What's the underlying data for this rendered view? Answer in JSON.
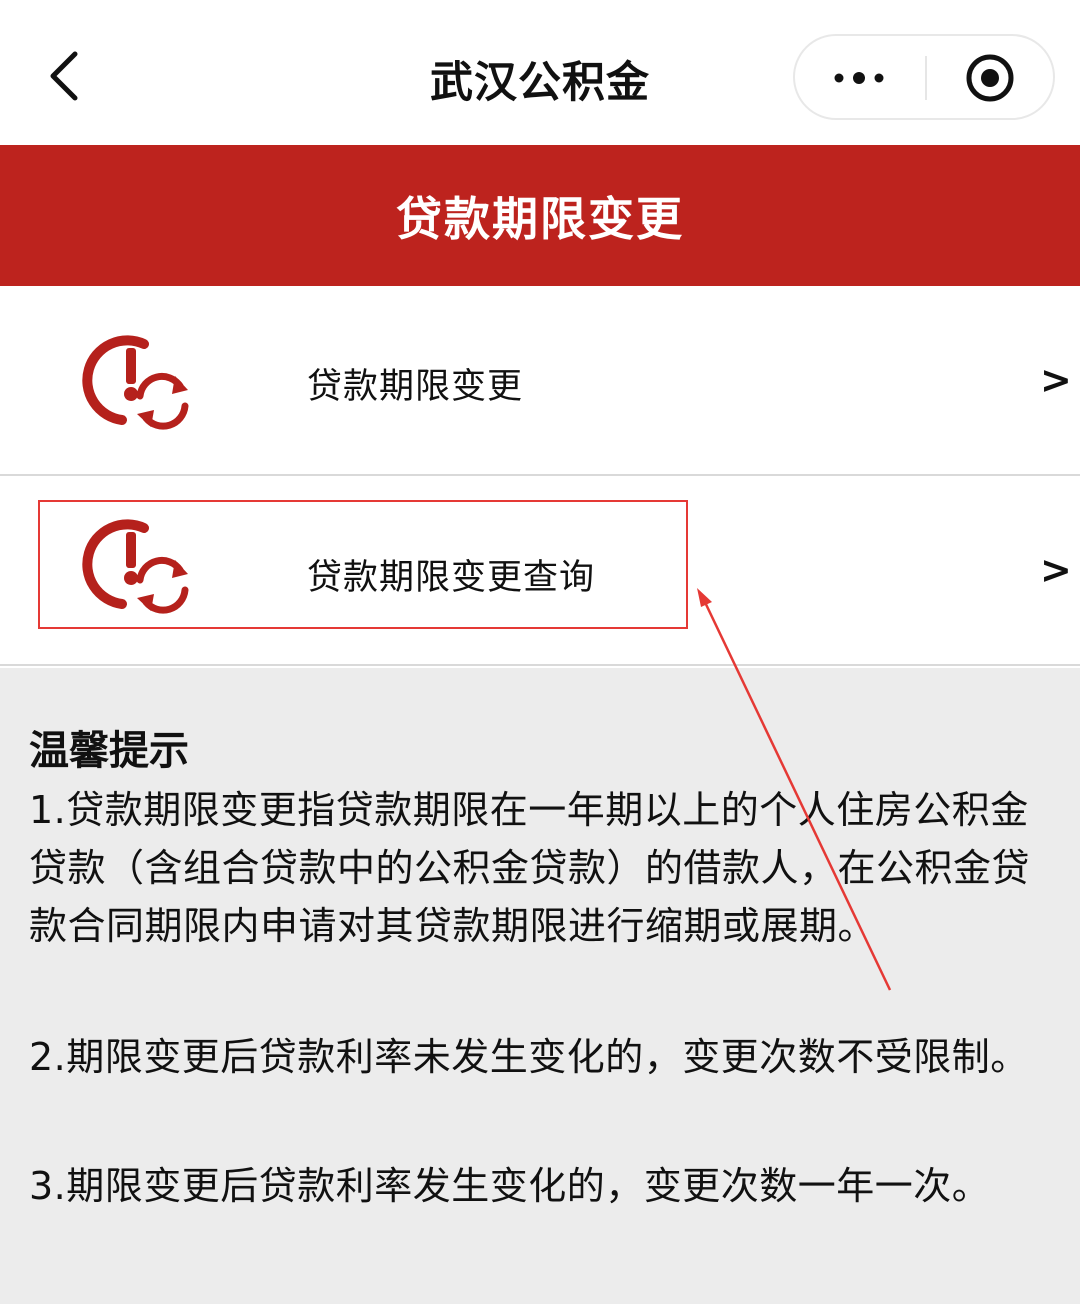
{
  "navbar": {
    "title": "武汉公积金",
    "back_icon": "chevron-left-icon",
    "more_icon": "more-dots-icon",
    "close_icon": "target-circle-icon"
  },
  "banner": {
    "title": "贷款期限变更",
    "color": "#bd231e"
  },
  "menu": {
    "items": [
      {
        "label": "贷款期限变更",
        "icon": "clock-refresh-icon",
        "arrow": ">"
      },
      {
        "label": "贷款期限变更查询",
        "icon": "clock-refresh-icon",
        "arrow": ">"
      }
    ]
  },
  "tips": {
    "title": "温馨提示",
    "items": [
      "1.贷款期限变更指贷款期限在一年期以上的个人住房公积金贷款（含组合贷款中的公积金贷款）的借款人，在公积金贷款合同期限内申请对其贷款期限进行缩期或展期。",
      "2.期限变更后贷款利率未发生变化的，变更次数不受限制。",
      "3.期限变更后贷款利率发生变化的，变更次数一年一次。"
    ]
  },
  "annotation": {
    "color": "#e53935"
  }
}
